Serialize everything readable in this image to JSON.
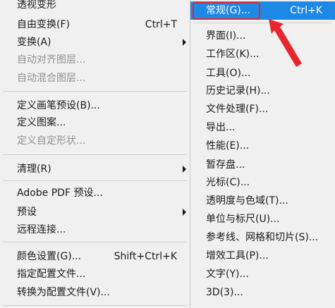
{
  "main_menu": {
    "items": [
      {
        "label": "透视变形",
        "shortcut": "",
        "disabled": false,
        "submenu": false
      },
      {
        "label": "自由变换(F)",
        "shortcut": "Ctrl+T",
        "disabled": false,
        "submenu": false
      },
      {
        "label": "变换(A)",
        "shortcut": "",
        "disabled": false,
        "submenu": true
      },
      {
        "label": "自动对齐图层...",
        "shortcut": "",
        "disabled": true,
        "submenu": false
      },
      {
        "label": "自动混合图层...",
        "shortcut": "",
        "disabled": true,
        "submenu": false
      },
      {
        "label": "定义画笔预设(B)...",
        "shortcut": "",
        "disabled": false,
        "submenu": false
      },
      {
        "label": "定义图案...",
        "shortcut": "",
        "disabled": false,
        "submenu": false
      },
      {
        "label": "定义自定形状...",
        "shortcut": "",
        "disabled": true,
        "submenu": false
      },
      {
        "label": "清理(R)",
        "shortcut": "",
        "disabled": false,
        "submenu": true
      },
      {
        "label": "Adobe PDF 预设...",
        "shortcut": "",
        "disabled": false,
        "submenu": false
      },
      {
        "label": "预设",
        "shortcut": "",
        "disabled": false,
        "submenu": true
      },
      {
        "label": "远程连接...",
        "shortcut": "",
        "disabled": false,
        "submenu": false
      },
      {
        "label": "颜色设置(G)...",
        "shortcut": "Shift+Ctrl+K",
        "disabled": false,
        "submenu": false
      },
      {
        "label": "指定配置文件...",
        "shortcut": "",
        "disabled": false,
        "submenu": false
      },
      {
        "label": "转换为配置文件(V)...",
        "shortcut": "",
        "disabled": false,
        "submenu": false
      }
    ]
  },
  "sub_menu": {
    "items": [
      {
        "label": "常规(G)...",
        "shortcut": "Ctrl+K",
        "highlighted": true
      },
      {
        "label": "界面(I)...",
        "shortcut": "",
        "highlighted": false
      },
      {
        "label": "工作区(K)...",
        "shortcut": "",
        "highlighted": false
      },
      {
        "label": "工具(O)...",
        "shortcut": "",
        "highlighted": false
      },
      {
        "label": "历史记录(H)...",
        "shortcut": "",
        "highlighted": false
      },
      {
        "label": "文件处理(F)...",
        "shortcut": "",
        "highlighted": false
      },
      {
        "label": "导出...",
        "shortcut": "",
        "highlighted": false
      },
      {
        "label": "性能(E)...",
        "shortcut": "",
        "highlighted": false
      },
      {
        "label": "暂存盘...",
        "shortcut": "",
        "highlighted": false
      },
      {
        "label": "光标(C)...",
        "shortcut": "",
        "highlighted": false
      },
      {
        "label": "透明度与色域(T)...",
        "shortcut": "",
        "highlighted": false
      },
      {
        "label": "单位与标尺(U)...",
        "shortcut": "",
        "highlighted": false
      },
      {
        "label": "参考线、网格和切片(S)...",
        "shortcut": "",
        "highlighted": false
      },
      {
        "label": "增效工具(P)...",
        "shortcut": "",
        "highlighted": false
      },
      {
        "label": "文字(Y)...",
        "shortcut": "",
        "highlighted": false
      },
      {
        "label": "3D(3)...",
        "shortcut": "",
        "highlighted": false
      }
    ]
  },
  "colors": {
    "highlight": "#1e88e5",
    "annotation": "#e8262d",
    "disabled_text": "#8f8f8f",
    "menu_bg": "#f0f0f0"
  }
}
